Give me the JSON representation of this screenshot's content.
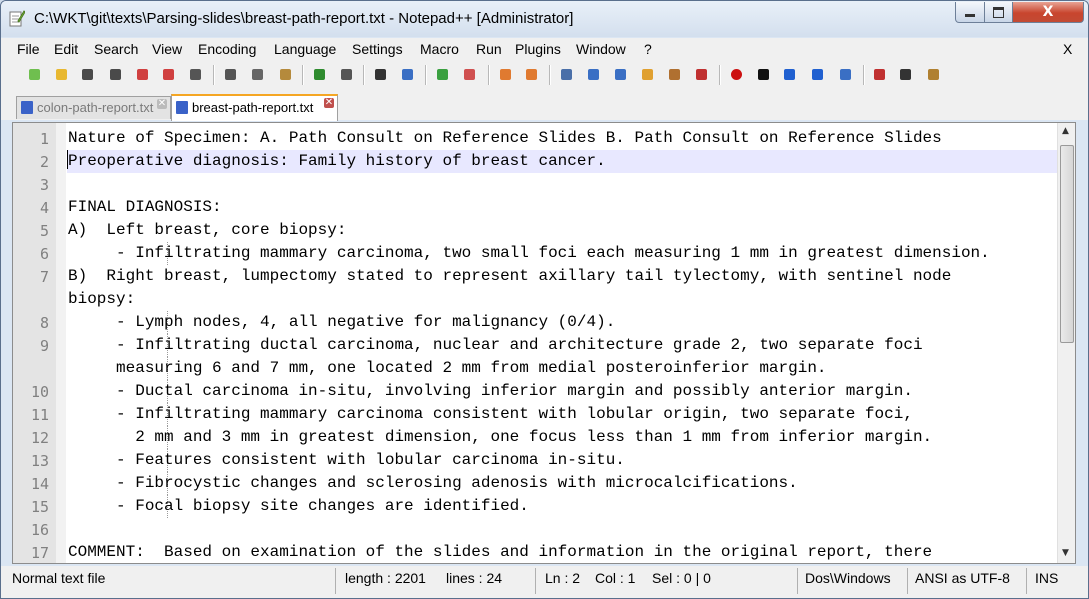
{
  "window": {
    "title": "C:\\WKT\\git\\texts\\Parsing-slides\\breast-path-report.txt - Notepad++ [Administrator]",
    "close_glyph": "X"
  },
  "menu": {
    "items": [
      "File",
      "Edit",
      "Search",
      "View",
      "Encoding",
      "Language",
      "Settings",
      "Macro",
      "Run",
      "Plugins",
      "Window",
      "?"
    ],
    "close": "X"
  },
  "toolbar": {
    "buttons": [
      "new-file-icon",
      "open-file-icon",
      "save-icon",
      "save-all-icon",
      "close-icon",
      "close-all-icon",
      "print-icon",
      "cut-icon",
      "copy-icon",
      "paste-icon",
      "undo-icon",
      "redo-icon",
      "find-icon",
      "replace-icon",
      "zoom-in-icon",
      "zoom-out-icon",
      "sync-vertical-icon",
      "sync-horizontal-icon",
      "word-wrap-icon",
      "show-all-chars-icon",
      "indent-guide-icon",
      "user-language-icon",
      "doc-map-icon",
      "function-list-icon",
      "record-macro-icon",
      "stop-record-icon",
      "play-macro-icon",
      "run-macro-multiple-icon",
      "save-macro-icon",
      "spell-check-icon",
      "hex-editor-icon",
      "compare-icon"
    ]
  },
  "tabs": [
    {
      "label": "colon-path-report.txt",
      "active": false,
      "close": "✕"
    },
    {
      "label": "breast-path-report.txt",
      "active": true,
      "close": "✕"
    }
  ],
  "editor": {
    "current_line": 2,
    "lines": [
      {
        "num": "1",
        "text": "Nature of Specimen: A. Path Consult on Reference Slides B. Path Consult on Reference Slides"
      },
      {
        "num": "2",
        "text": "Preoperative diagnosis: Family history of breast cancer."
      },
      {
        "num": "3",
        "text": ""
      },
      {
        "num": "4",
        "text": "FINAL DIAGNOSIS:"
      },
      {
        "num": "5",
        "text": "A)  Left breast, core biopsy:"
      },
      {
        "num": "6",
        "text": "     - Infiltrating mammary carcinoma, two small foci each measuring 1 mm in greatest dimension."
      },
      {
        "num": "7",
        "text": "B)  Right breast, lumpectomy stated to represent axillary tail tylectomy, with sentinel node"
      },
      {
        "num": "",
        "text": "biopsy:"
      },
      {
        "num": "8",
        "text": "     - Lymph nodes, 4, all negative for malignancy (0/4)."
      },
      {
        "num": "9",
        "text": "     - Infiltrating ductal carcinoma, nuclear and architecture grade 2, two separate foci"
      },
      {
        "num": "",
        "text": "     measuring 6 and 7 mm, one located 2 mm from medial posteroinferior margin."
      },
      {
        "num": "10",
        "text": "     - Ductal carcinoma in-situ, involving inferior margin and possibly anterior margin."
      },
      {
        "num": "11",
        "text": "     - Infiltrating mammary carcinoma consistent with lobular origin, two separate foci,"
      },
      {
        "num": "12",
        "text": "       2 mm and 3 mm in greatest dimension, one focus less than 1 mm from inferior margin."
      },
      {
        "num": "13",
        "text": "     - Features consistent with lobular carcinoma in-situ."
      },
      {
        "num": "14",
        "text": "     - Fibrocystic changes and sclerosing adenosis with microcalcifications."
      },
      {
        "num": "15",
        "text": "     - Focal biopsy site changes are identified."
      },
      {
        "num": "16",
        "text": ""
      },
      {
        "num": "17",
        "text": "COMMENT:  Based on examination of the slides and information in the original report, there"
      }
    ],
    "scroll_up": "▲",
    "scroll_down": "▼"
  },
  "status": {
    "file_type": "Normal text file",
    "length": "length : 2201",
    "lines": "lines : 24",
    "ln": "Ln : 2",
    "col": "Col : 1",
    "sel": "Sel : 0 | 0",
    "eol": "Dos\\Windows",
    "encoding": "ANSI as UTF-8",
    "mode": "INS"
  },
  "colors": {
    "current_line": "#e8e8ff",
    "active_tab_accent": "#f5a623",
    "close_button": "#c8452e"
  }
}
